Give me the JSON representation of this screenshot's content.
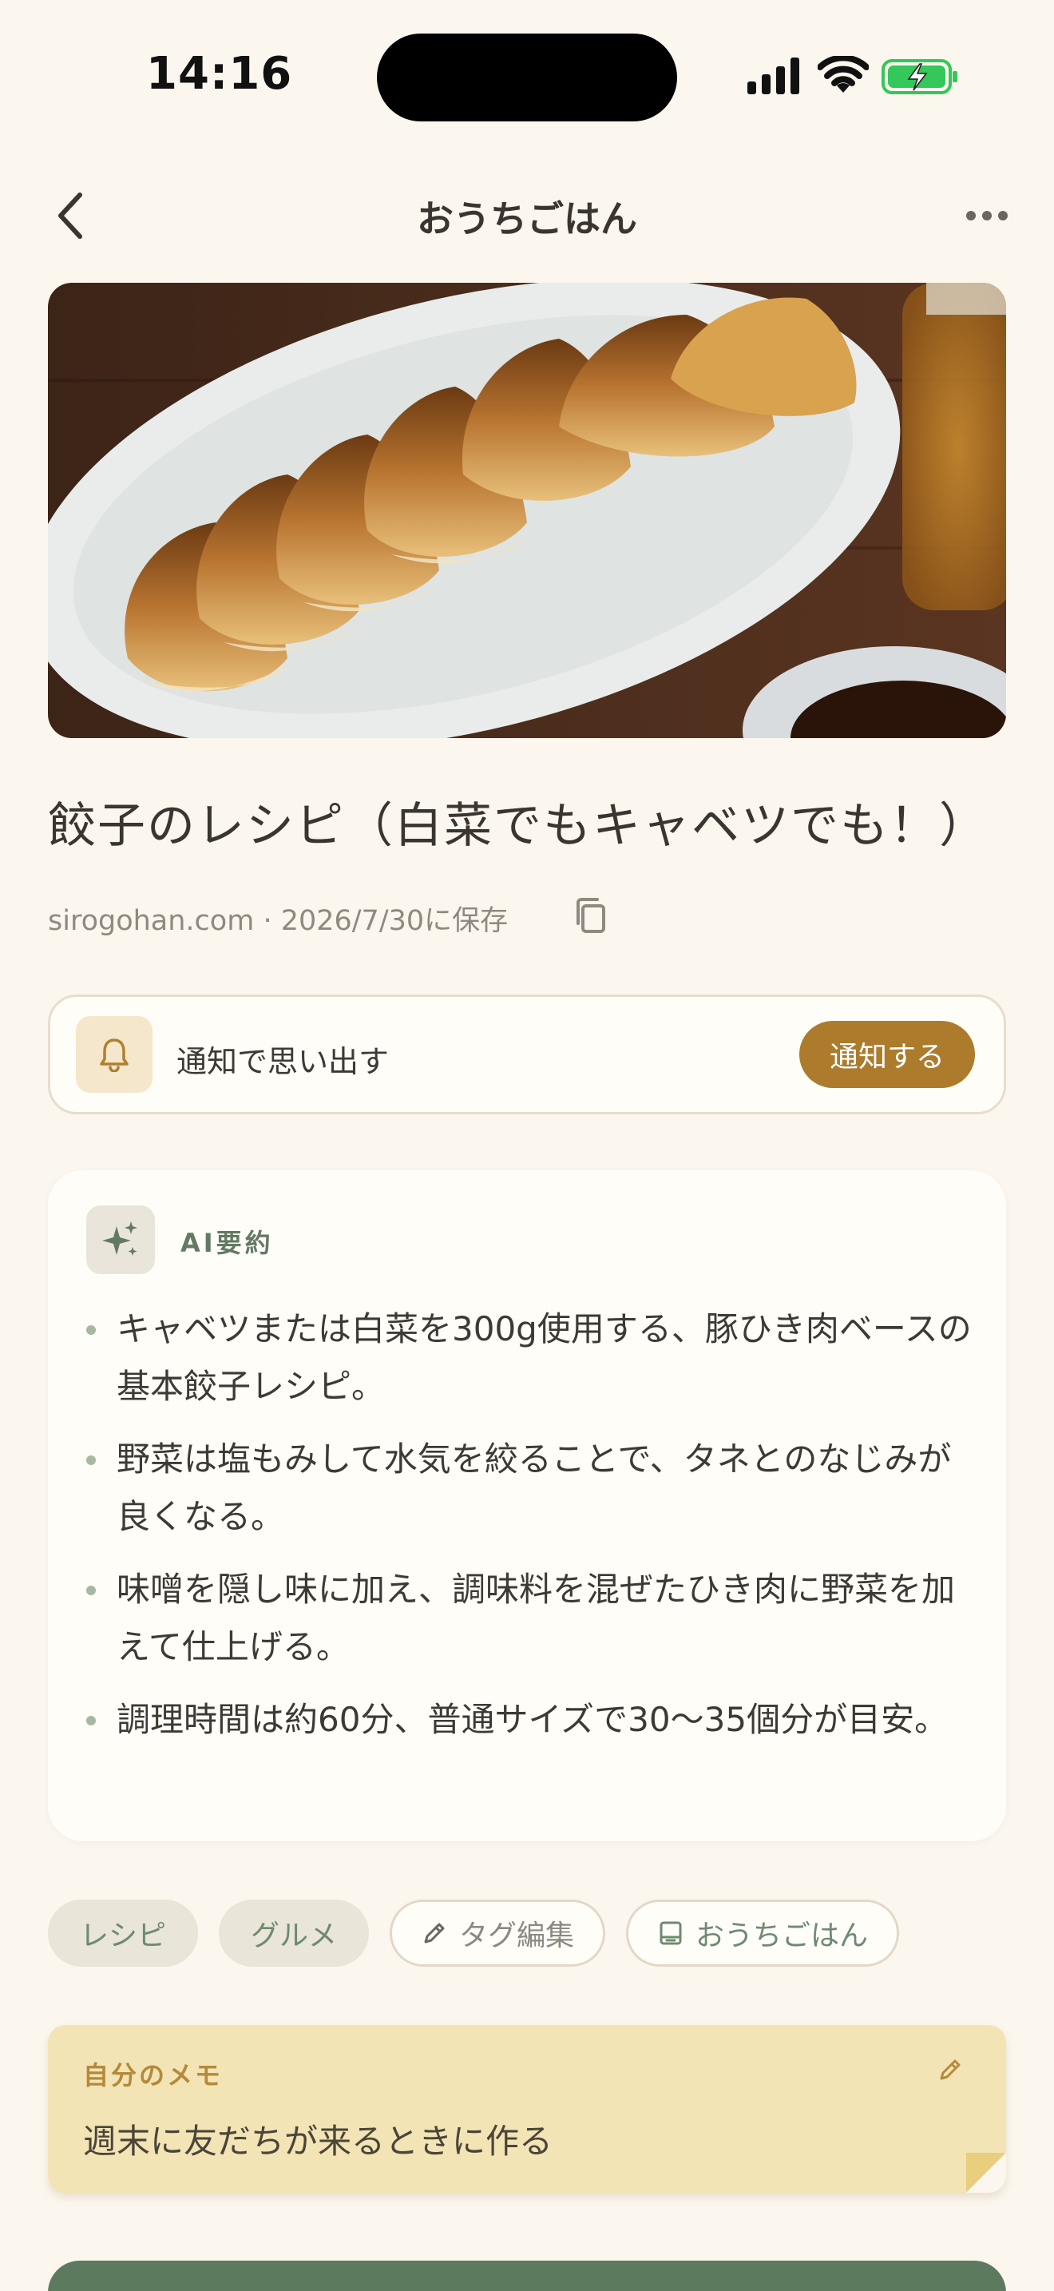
{
  "status_bar": {
    "time": "14:16"
  },
  "nav": {
    "title": "おうちごはん"
  },
  "article": {
    "title": "餃子のレシピ（白菜でもキャベツでも！）",
    "meta": "sirogohan.com · 2026/7/30に保存"
  },
  "reminder": {
    "label": "通知で思い出す",
    "button": "通知する"
  },
  "ai_summary": {
    "label": "AI要約",
    "items": [
      "キャベツまたは白菜を300g使用する、豚ひき肉ベースの基本餃子レシピ。",
      "野菜は塩もみして水気を絞ることで、タネとのなじみが良くなる。",
      "味噌を隠し味に加え、調味料を混ぜたひき肉に野菜を加えて仕上げる。",
      "調理時間は約60分、普通サイズで30〜35個分が目安。"
    ]
  },
  "tags": {
    "items": [
      "レシピ",
      "グルメ"
    ],
    "edit_label": "タグ編集",
    "collection_label": "おうちごはん"
  },
  "memo": {
    "label": "自分のメモ",
    "text": "週末に友だちが来るときに作る"
  },
  "colors": {
    "background": "#fbf6ee",
    "accent_brown": "#ac7b2c",
    "accent_green": "#5c7a5e",
    "memo_yellow": "#f3e4b6"
  },
  "icons": [
    "chevron-left-icon",
    "more-icon",
    "copy-icon",
    "bell-icon",
    "sparkle-icon",
    "pencil-icon",
    "collection-icon"
  ]
}
